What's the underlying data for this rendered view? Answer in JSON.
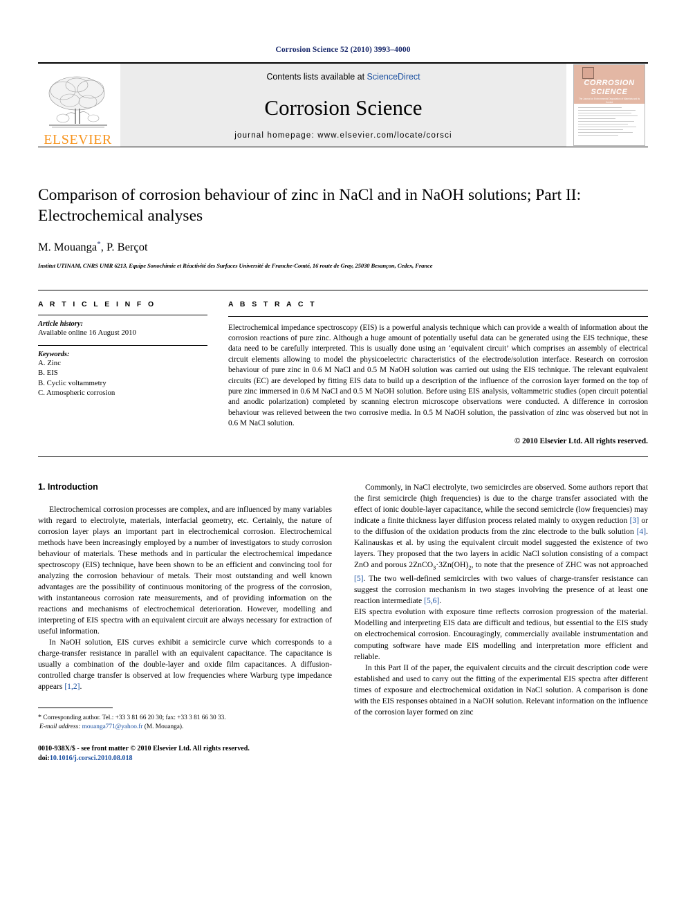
{
  "running_head": "Corrosion Science 52 (2010) 3993–4000",
  "banner": {
    "publisher_name": "ELSEVIER",
    "contents_prefix": "Contents lists available at ",
    "contents_link": "ScienceDirect",
    "journal_name": "Corrosion Science",
    "homepage": "journal homepage: www.elsevier.com/locate/corsci",
    "cover": {
      "title_line1": "CORROSION",
      "title_line2": "SCIENCE",
      "subtitle": "The Journal on Environmental Degradation of Materials and its Control",
      "subtitle2": "An Official Journal of the Institute of Corrosion"
    }
  },
  "article": {
    "title": "Comparison of corrosion behaviour of zinc in NaCl and in NaOH solutions; Part II: Electrochemical analyses",
    "authors": "M. Mouanga",
    "authors_rest": ", P. Berçot",
    "corresponding_marker": "*",
    "affiliation": "Institut UTINAM, CNRS UMR 6213, Equipe Sonochimie et Réactivité des Surfaces Université de Franche-Comté, 16 route de Gray, 25030 Besançon, Cedex, France"
  },
  "article_info": {
    "heading": "A R T I C L E    I N F O",
    "history_label": "Article history:",
    "history_value": "Available online 16 August 2010",
    "keywords_label": "Keywords:",
    "keywords": [
      "A. Zinc",
      "B. EIS",
      "B. Cyclic voltammetry",
      "C. Atmospheric corrosion"
    ]
  },
  "abstract": {
    "heading": "A B S T R A C T",
    "text": "Electrochemical impedance spectroscopy (EIS) is a powerful analysis technique which can provide a wealth of information about the corrosion reactions of pure zinc. Although a huge amount of potentially useful data can be generated using the EIS technique, these data need to be carefully interpreted. This is usually done using an ‘equivalent circuit’ which comprises an assembly of electrical circuit elements allowing to model the physicoelectric characteristics of the electrode/solution interface. Research on corrosion behaviour of pure zinc in 0.6 M NaCl and 0.5 M NaOH solution was carried out using the EIS technique. The relevant equivalent circuits (EC) are developed by fitting EIS data to build up a description of the influence of the corrosion layer formed on the top of pure zinc immersed in 0.6 M NaCl and 0.5 M NaOH solution. Before using EIS analysis, voltammetric studies (open circuit potential and anodic polarization) completed by scanning electron microscope observations were conducted. A difference in corrosion behaviour was relieved between the two corrosive media. In 0.5 M NaOH solution, the passivation of zinc was observed but not in 0.6 M NaCl solution.",
    "copyright": "© 2010 Elsevier Ltd. All rights reserved."
  },
  "body": {
    "section_heading": "1. Introduction",
    "left_paragraphs": [
      "Electrochemical corrosion processes are complex, and are influenced by many variables with regard to electrolyte, materials, interfacial geometry, etc. Certainly, the nature of corrosion layer plays an important part in electrochemical corrosion. Electrochemical methods have been increasingly employed by a number of investigators to study corrosion behaviour of materials. These methods and in particular the electrochemical impedance spectroscopy (EIS) technique, have been shown to be an efficient and convincing tool for analyzing the corrosion behaviour of metals. Their most outstanding and well known advantages are the possibility of continuous monitoring of the progress of the corrosion, with instantaneous corrosion rate measurements, and of providing information on the reactions and mechanisms of electrochemical deterioration. However, modelling and interpreting of EIS spectra with an equivalent circuit are always necessary for extraction of useful information."
    ],
    "left_para2_pre": "In NaOH solution, EIS curves exhibit a semicircle curve which corresponds to a charge-transfer resistance in parallel with an equivalent capacitance. The capacitance is usually a combination of the double-layer and oxide film capacitances. A diffusion-controlled charge transfer is observed at low frequencies where Warburg type impedance appears ",
    "left_para2_ref": "[1,2]",
    "left_para2_post": ".",
    "right_p1_a": "Commonly, in NaCl electrolyte, two semicircles are observed. Some authors report that the first semicircle (high frequencies) is due to the charge transfer associated with the effect of ionic double-layer capacitance, while the second semicircle (low frequencies) may indicate a finite thickness layer diffusion process related mainly to oxygen reduction ",
    "right_p1_r1": "[3]",
    "right_p1_b": " or to the diffusion of the oxidation products from the zinc electrode to the bulk solution ",
    "right_p1_r2": "[4]",
    "right_p1_c": ". Kalinauskas et al. by using the equivalent circuit model suggested the existence of two layers. They proposed that the two layers in acidic NaCl solution consisting of a compact ZnO and porous 2ZnCO",
    "right_p1_sub1": "3",
    "right_p1_d": "·3Zn(OH)",
    "right_p1_sub2": "2",
    "right_p1_e": ", to note that the presence of ZHC was not approached ",
    "right_p1_r3": "[5]",
    "right_p1_f": ". The two well-defined semicircles with two values of charge-transfer resistance can suggest the corrosion mechanism in two stages involving the presence of at least one reaction intermediate ",
    "right_p1_r4": "[5,6]",
    "right_p1_g": ".",
    "right_p2": "EIS spectra evolution with exposure time reflects corrosion progression of the material. Modelling and interpreting EIS data are difficult and tedious, but essential to the EIS study on electrochemical corrosion. Encouragingly, commercially available instrumentation and computing software have made EIS modelling and interpretation more efficient and reliable.",
    "right_p3": "In this Part II of the paper, the equivalent circuits and the circuit description code were established and used to carry out the fitting of the experimental EIS spectra after different times of exposure and electrochemical oxidation in NaCl solution. A comparison is done with the EIS responses obtained in a NaOH solution. Relevant information on the influence of the corrosion layer formed on zinc"
  },
  "footnote": {
    "marker": "*",
    "corresponding": "Corresponding author. Tel.: +33 3 81 66 20 30; fax: +33 3 81 66 30 33.",
    "email_label": "E-mail address:",
    "email": "mouanga771@yahoo.fr",
    "email_owner": "(M. Mouanga)."
  },
  "imprint": {
    "line1_pre": "0010-938X/$ - see front matter © 2010 Elsevier Ltd. All rights reserved.",
    "doi_label": "doi:",
    "doi": "10.1016/j.corsci.2010.08.018"
  },
  "colors": {
    "accent_blue": "#1a4fa0",
    "header_blue": "#1a2a6c",
    "elsevier_orange": "#F7941E",
    "banner_gray": "#ececec",
    "cover_salmon": "#e3b7a4"
  }
}
